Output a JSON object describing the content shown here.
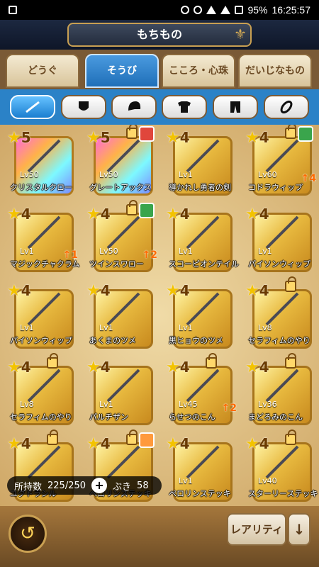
{
  "status_bar": {
    "time": "16:25:57",
    "battery": "95%"
  },
  "header": {
    "title": "もちもの"
  },
  "main_tabs": [
    {
      "label": "どうぐ",
      "active": false
    },
    {
      "label": "そうび",
      "active": true
    },
    {
      "label": "こころ・心珠",
      "active": false
    },
    {
      "label": "だいじなもの",
      "active": false
    }
  ],
  "sub_tabs": [
    {
      "icon": "sword-icon",
      "active": true
    },
    {
      "icon": "shield-icon",
      "active": false
    },
    {
      "icon": "helmet-icon",
      "active": false
    },
    {
      "icon": "shirt-icon",
      "active": false
    },
    {
      "icon": "pants-icon",
      "active": false
    },
    {
      "icon": "accessory-icon",
      "active": false
    }
  ],
  "items": [
    {
      "stars": "5",
      "level": "Lv50",
      "name": "クリスタルクロー",
      "rainbow": true,
      "lock": false,
      "portrait": false,
      "up": ""
    },
    {
      "stars": "5",
      "level": "Lv50",
      "name": "グレートアックス",
      "rainbow": true,
      "lock": true,
      "portrait": true,
      "up": ""
    },
    {
      "stars": "4",
      "level": "Lv1",
      "name": "導かれし勇者の剣",
      "rainbow": false,
      "lock": false,
      "portrait": false,
      "up": ""
    },
    {
      "stars": "4",
      "level": "Lv60",
      "name": "コドラウィップ",
      "rainbow": false,
      "lock": true,
      "portrait": true,
      "up": "4"
    },
    {
      "stars": "4",
      "level": "Lv1",
      "name": "マジックチャクラム",
      "rainbow": false,
      "lock": false,
      "portrait": false,
      "up": "1"
    },
    {
      "stars": "4",
      "level": "Lv50",
      "name": "ツインスワロー",
      "rainbow": false,
      "lock": true,
      "portrait": true,
      "up": "2"
    },
    {
      "stars": "4",
      "level": "Lv1",
      "name": "スコーピオンテイル",
      "rainbow": false,
      "lock": false,
      "portrait": false,
      "up": ""
    },
    {
      "stars": "4",
      "level": "Lv1",
      "name": "パイソンウィップ",
      "rainbow": false,
      "lock": false,
      "portrait": false,
      "up": ""
    },
    {
      "stars": "4",
      "level": "Lv1",
      "name": "パイソンウィップ",
      "rainbow": false,
      "lock": false,
      "portrait": false,
      "up": ""
    },
    {
      "stars": "4",
      "level": "Lv1",
      "name": "あくまのツメ",
      "rainbow": false,
      "lock": false,
      "portrait": false,
      "up": ""
    },
    {
      "stars": "4",
      "level": "Lv1",
      "name": "黒ヒョウのツメ",
      "rainbow": false,
      "lock": false,
      "portrait": false,
      "up": ""
    },
    {
      "stars": "4",
      "level": "Lv8",
      "name": "セラフィムのやり",
      "rainbow": false,
      "lock": true,
      "portrait": false,
      "up": ""
    },
    {
      "stars": "4",
      "level": "Lv8",
      "name": "セラフィムのやり",
      "rainbow": false,
      "lock": true,
      "portrait": false,
      "up": ""
    },
    {
      "stars": "4",
      "level": "Lv1",
      "name": "パルチザン",
      "rainbow": false,
      "lock": false,
      "portrait": false,
      "up": ""
    },
    {
      "stars": "4",
      "level": "Lv45",
      "name": "らせつのこん",
      "rainbow": false,
      "lock": true,
      "portrait": false,
      "up": "2"
    },
    {
      "stars": "4",
      "level": "Lv36",
      "name": "まどろみのこん",
      "rainbow": false,
      "lock": true,
      "portrait": false,
      "up": ""
    },
    {
      "stars": "4",
      "level": "",
      "name": "ユグドラシル",
      "rainbow": false,
      "lock": true,
      "portrait": false,
      "up": ""
    },
    {
      "stars": "4",
      "level": "",
      "name": "ペロリンステッキ",
      "rainbow": false,
      "lock": true,
      "portrait": true,
      "up": ""
    },
    {
      "stars": "4",
      "level": "Lv1",
      "name": "ペロリンステッキ",
      "rainbow": false,
      "lock": false,
      "portrait": false,
      "up": ""
    },
    {
      "stars": "4",
      "level": "Lv40",
      "name": "スターリーステッキ",
      "rainbow": false,
      "lock": true,
      "portrait": false,
      "up": ""
    }
  ],
  "holding": {
    "label": "所持数",
    "value": "225/250",
    "plus": "+",
    "weapon_label": "ぶき",
    "weapon_count": "58"
  },
  "bottom": {
    "back_icon": "back-arrow-icon",
    "rarity_label": "レアリティ",
    "sort_arrow": "↓"
  },
  "colors": {
    "accent_blue": "#2b82c7",
    "gold": "#c9a052"
  }
}
